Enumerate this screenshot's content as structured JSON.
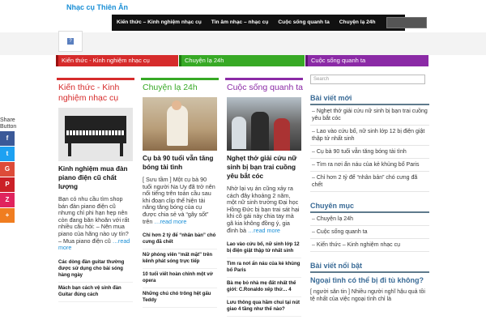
{
  "header": {
    "site_title": "Nhạc cụ Thiên Ân",
    "nav": [
      "Kiến thức – Kinh nghiệm nhạc cụ",
      "Tin âm nhạc – nhạc cụ",
      "Cuộc sống quanh ta",
      "Chuyện lạ 24h"
    ]
  },
  "category_bar": [
    "Kiến thức - Kinh nghiệm nhạc cụ",
    "Chuyện lạ 24h",
    "Cuộc sống quanh ta"
  ],
  "share": {
    "label": "Share Button",
    "buttons": [
      {
        "icon": "facebook-icon",
        "glyph": "f",
        "color": "#3b5998"
      },
      {
        "icon": "twitter-icon",
        "glyph": "t",
        "color": "#1da1f2"
      },
      {
        "icon": "google-plus-icon",
        "glyph": "G",
        "color": "#dd4b39"
      },
      {
        "icon": "pinterest-icon",
        "glyph": "P",
        "color": "#cb2027"
      },
      {
        "icon": "zing-icon",
        "glyph": "Z",
        "color": "#e0245e"
      },
      {
        "icon": "more-icon",
        "glyph": "+",
        "color": "#f07d20"
      }
    ]
  },
  "columns": [
    {
      "heading": "Kiến thức - Kinh nghiệm nhạc cụ",
      "post_title": "Kinh nghiệm mua đàn piano điện cũ chất lượng",
      "excerpt": "Bạn có nhu cầu tìm shop bán đàn piano điện cũ nhưng chỉ phi hạn hẹp nên còn đang băn khoăn với rất nhiều câu hỏi: – Nên mua piano của hãng nào uy tín? – Mua piano điện cũ ",
      "read_more": "…read more",
      "small_items": [
        "Các dòng đàn guitar thường được sử dụng cho bài sóng hàng ngày",
        "Mách bạn cách vệ sinh đàn Guitar đúng cách"
      ]
    },
    {
      "heading": "Chuyện lạ 24h",
      "post_title": "Cụ bà 90 tuổi vẫn tăng bóng tài tình",
      "excerpt": "[ Sưu tầm ] Một cụ bà 90 tuổi người Na Uy đã trở nên nổi tiếng trên toàn cầu sau khi đoạn clip thể hiện tài năng tăng bóng của cụ được chia sẻ và “gây sốt” trên ",
      "read_more": "…read more",
      "small_items": [
        "Chỉ hơn 2 tỷ để “nhân bản” chó cưng đã chết",
        "Nữ phóng viên “mất mặt” trên kênh phát sóng trực tiếp",
        "10 tuổi viết hoàn chỉnh một vở opera",
        "Những chú chó trông hệt gấu Teddy"
      ]
    },
    {
      "heading": "Cuộc sống quanh ta",
      "post_title": "Nghẹt thở giải cứu nữ sinh bị bạn trai cuồng yêu bắt cóc",
      "excerpt": "Nhờ lại vụ án cũng xảy ra cách đây khoảng 2 năm, một nữ sinh trường Đại học Hồng Đức bị bạn trai sát hại khi cô gái này chia tay mà gã kia không đồng ý, gia đình bà ",
      "read_more": "…read more",
      "small_items": [
        "Lao vào cứu bố, nữ sinh lớp 12 bị điện giật thập tử nhất sinh",
        "Tìm ra nơi ẩn náu của kẻ khủng bố Paris",
        "Bà mẹ bỏ nhà mẹ đất nhất thế giới: C.Ronaldo xếp thứ… 4",
        "Lưu thông qua hầm chui tại nút giao 4 tầng như thế nào?"
      ]
    }
  ],
  "sidebar": {
    "search_placeholder": "Search",
    "recent_title": "Bài viết mới",
    "recent": [
      "Nghẹt thở giải cứu nữ sinh bị bạn trai cuồng yêu bắt cóc",
      "Lao vào cứu bố, nữ sinh lớp 12 bị điện giật thập tử nhất sinh",
      "Cụ bà 90 tuổi vẫn tăng bóng tài tình",
      "Tìm ra nơi ẩn náu của kẻ khủng bố Paris",
      "Chỉ hơn 2 tỷ để “nhân bản” chó cưng đã chết"
    ],
    "categories_title": "Chuyên mục",
    "categories": [
      "Chuyện lạ 24h",
      "Cuộc sống quanh ta",
      "Kiến thức – Kinh nghiệm nhạc cụ"
    ],
    "featured_title": "Bài viết nổi bật",
    "featured_post_title": "Ngoại tình có thể bị đi tù không?",
    "featured_text": "[ người sân tin ] Nhiều người nghĩ hậu quả tồi tệ nhất của việc ngoại tình chỉ là"
  }
}
